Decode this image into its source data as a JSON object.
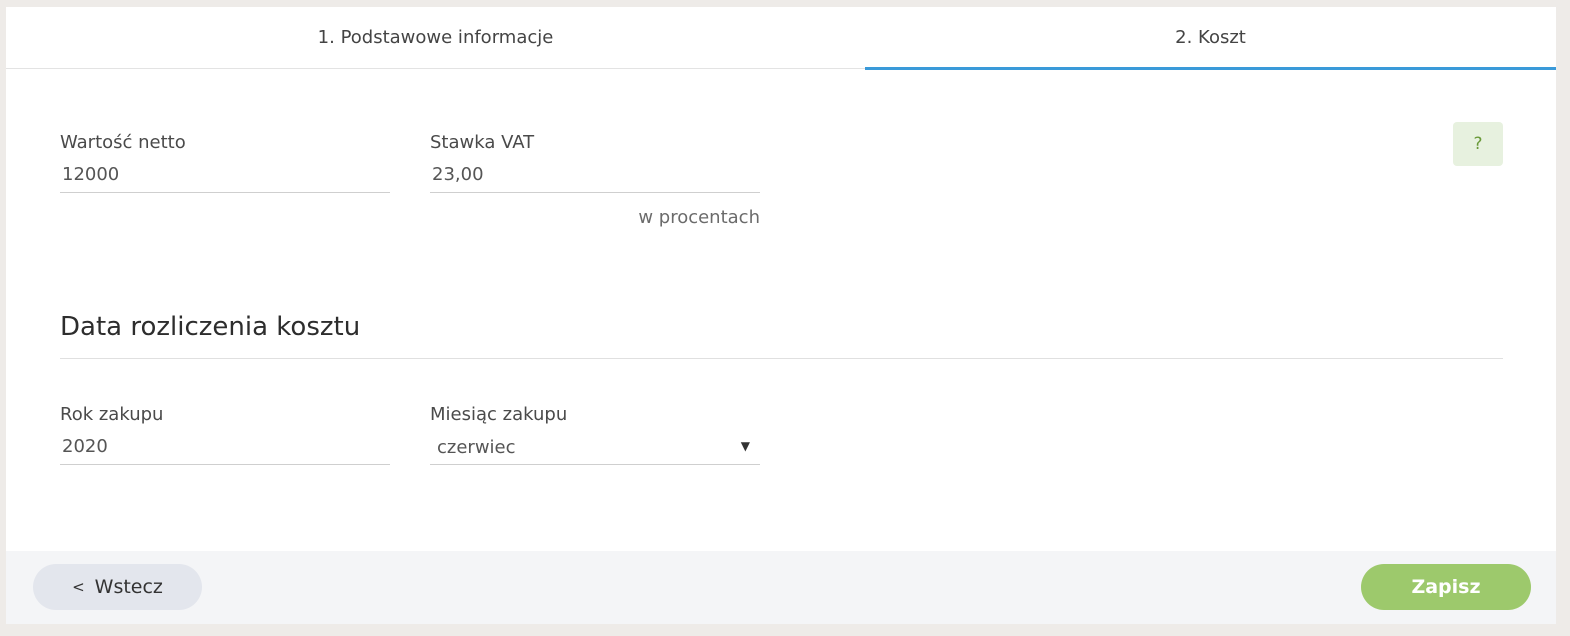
{
  "tabs": [
    {
      "label": "1. Podstawowe informacje",
      "active": false
    },
    {
      "label": "2. Koszt",
      "active": true
    }
  ],
  "cost": {
    "net_value": {
      "label": "Wartość netto",
      "value": "12000"
    },
    "vat_rate": {
      "label": "Stawka VAT",
      "value": "23,00",
      "hint": "w procentach"
    }
  },
  "help_button": {
    "label": "?"
  },
  "settlement": {
    "title": "Data rozliczenia kosztu",
    "year": {
      "label": "Rok zakupu",
      "value": "2020"
    },
    "month": {
      "label": "Miesiąc zakupu",
      "selected": "czerwiec"
    }
  },
  "footer": {
    "back_label": "Wstecz",
    "save_label": "Zapisz"
  },
  "colors": {
    "accent_tab": "#3a9ad9",
    "save_button": "#9dc96c",
    "help_button_bg": "#e7f1df"
  },
  "icons": {
    "back": "chevron-left-icon",
    "select": "caret-down-icon"
  }
}
